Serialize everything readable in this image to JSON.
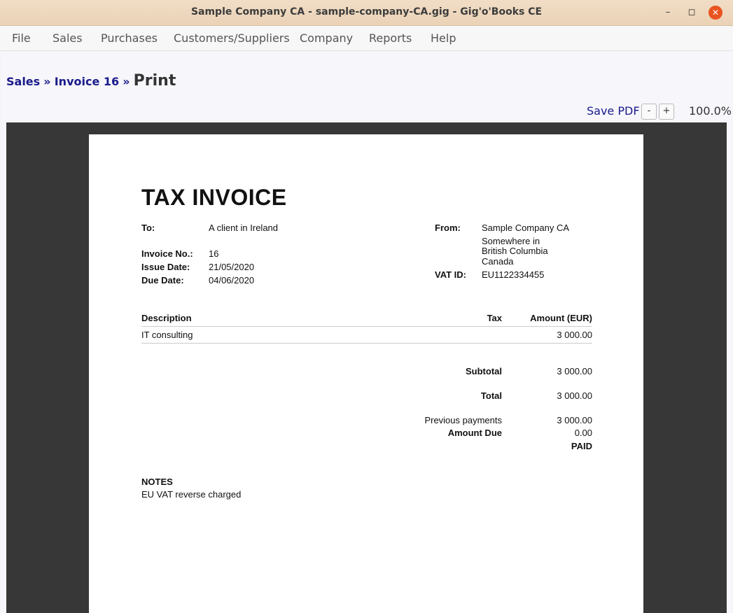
{
  "window": {
    "title": "Sample Company CA - sample-company-CA.gig - Gig'o'Books CE",
    "minimize": "–",
    "maximize": "◻",
    "close": "✕"
  },
  "menu": [
    "File",
    "Sales",
    "Purchases",
    "Customers/Suppliers",
    "Company",
    "Reports",
    "Help"
  ],
  "breadcrumb": {
    "sales": "Sales",
    "sep1": "»",
    "invoice": "Invoice 16",
    "sep2": "»",
    "current": "Print"
  },
  "toolbar": {
    "save_pdf": "Save PDF",
    "zoom_out": "-",
    "zoom_in": "+",
    "zoom_level": "100.0%"
  },
  "invoice": {
    "heading": "TAX INVOICE",
    "to_label": "To:",
    "to_value": "A client in Ireland",
    "invoice_no_label": "Invoice No.:",
    "invoice_no": "16",
    "issue_date_label": "Issue Date:",
    "issue_date": "21/05/2020",
    "due_date_label": "Due Date:",
    "due_date": "04/06/2020",
    "from_label": "From:",
    "from_lines": [
      "Sample Company CA",
      "Somewhere in",
      "British Columbia",
      "Canada"
    ],
    "vat_label": "VAT ID:",
    "vat_value": "EU1122334455",
    "columns": {
      "description": "Description",
      "tax": "Tax",
      "amount": "Amount (EUR)"
    },
    "lines": [
      {
        "description": "IT consulting",
        "tax": "",
        "amount": "3 000.00"
      }
    ],
    "subtotal_label": "Subtotal",
    "subtotal": "3 000.00",
    "total_label": "Total",
    "total": "3 000.00",
    "prev_payments_label": "Previous payments",
    "prev_payments": "3 000.00",
    "amount_due_label": "Amount Due",
    "amount_due": "0.00",
    "status": "PAID",
    "notes_label": "NOTES",
    "notes": "EU VAT reverse charged"
  }
}
